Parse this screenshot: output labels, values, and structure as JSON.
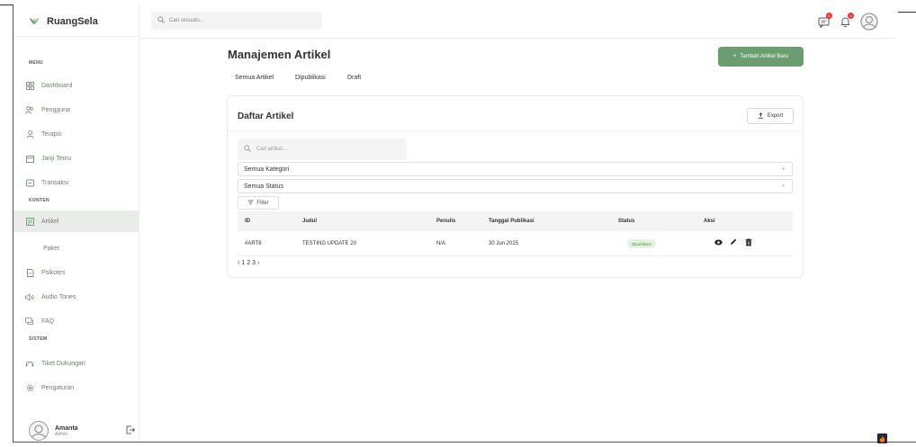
{
  "brand": {
    "name": "RuangSela",
    "icon": "leaf-icon"
  },
  "sidebar": {
    "sections": [
      {
        "label": "MENU"
      },
      {
        "label": "KONTEN"
      },
      {
        "label": "SISTEM"
      }
    ],
    "items": [
      {
        "label": "Dashboard",
        "icon": "dashboard-icon"
      },
      {
        "label": "Pengguna",
        "icon": "users-icon"
      },
      {
        "label": "Terapis",
        "icon": "user-icon"
      },
      {
        "label": "Janji Temu",
        "icon": "calendar-icon"
      },
      {
        "label": "Transaksi",
        "icon": "transaction-icon"
      },
      {
        "label": "Artikel",
        "icon": "article-icon",
        "active": true
      },
      {
        "label": "Paket"
      },
      {
        "label": "Psikotes",
        "icon": "document-icon"
      },
      {
        "label": "Audio Tones",
        "icon": "speaker-icon"
      },
      {
        "label": "FAQ",
        "icon": "faq-icon"
      },
      {
        "label": "Tiket Dukungan",
        "icon": "headset-icon"
      },
      {
        "label": "Pengaturan",
        "icon": "gear-icon"
      }
    ],
    "user": {
      "name": "Amanta",
      "role": "Admin"
    }
  },
  "topbar": {
    "search_placeholder": "Cari sesuatu...",
    "badges": {
      "messages": "0",
      "notifications": "0"
    }
  },
  "main": {
    "title": "Manajemen Artikel",
    "add_button": "Tambah Artikel Baru",
    "tabs": [
      {
        "label": "Semua Artikel"
      },
      {
        "label": "Dipublikasi"
      },
      {
        "label": "Draft"
      }
    ],
    "card": {
      "title": "Daftar Artikel",
      "export_label": "Export",
      "search_placeholder": "Cari artikel...",
      "category_select": "Semua Kategori",
      "status_select": "Semua Status",
      "filter_label": "Filter",
      "columns": [
        "ID",
        "Judul",
        "Penulis",
        "Tanggal Publikasi",
        "Status",
        "Aksi"
      ],
      "rows": [
        {
          "id": "#ART8",
          "title": "TESTING UPDATE 20",
          "author": "N/A",
          "date": "30 Jun 2025",
          "status": "Dipublikasi"
        }
      ],
      "pagination": {
        "prev": "‹",
        "pages": [
          "1",
          "2",
          "3"
        ],
        "next": "›"
      }
    }
  },
  "colors": {
    "accent": "#6b9d70",
    "active_bg": "#e9ece9",
    "status_bg": "#e3f3e0",
    "badge": "#e53935"
  }
}
